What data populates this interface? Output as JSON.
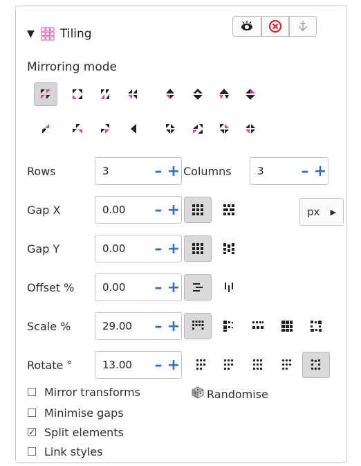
{
  "panel": {
    "title": "Tiling",
    "collapse_icon": "caret-down-icon",
    "title_icon": "tiling-grid-icon",
    "title_buttons": [
      "visibility-eye-icon",
      "close-circle-icon",
      "anchor-icon"
    ]
  },
  "mirroring": {
    "label": "Mirroring mode",
    "modes_row1": [
      "p1",
      "p2",
      "pm",
      "pg",
      "cm",
      "pmm",
      "pmg",
      "pgg"
    ],
    "modes_row2": [
      "cmm",
      "p4",
      "p4m",
      "p4g",
      "p3",
      "p31m",
      "p3m1",
      "p6"
    ],
    "selected_index": 0
  },
  "rows": {
    "label": "Rows",
    "value": "3"
  },
  "columns": {
    "label": "Columns",
    "value": "3"
  },
  "gap_x": {
    "label": "Gap X",
    "value": "0.00"
  },
  "gap_y": {
    "label": "Gap Y",
    "value": "0.00"
  },
  "offset": {
    "label": "Offset %",
    "value": "0.00"
  },
  "scale": {
    "label": "Scale %",
    "value": "29.00"
  },
  "rotate": {
    "label": "Rotate °",
    "value": "13.00"
  },
  "unit": {
    "label": "px"
  },
  "options": {
    "mirror_transforms": {
      "label": "Mirror transforms",
      "checked": false
    },
    "minimise_gaps": {
      "label": "Minimise gaps",
      "checked": false
    },
    "split_elements": {
      "label": "Split elements",
      "checked": true
    },
    "link_styles": {
      "label": "Link styles",
      "checked": false
    }
  },
  "randomise": {
    "label": "Randomise"
  },
  "colors": {
    "accent": "#2e6ec7",
    "magenta": "#d63384",
    "selected_bg": "#d6d6d6"
  }
}
